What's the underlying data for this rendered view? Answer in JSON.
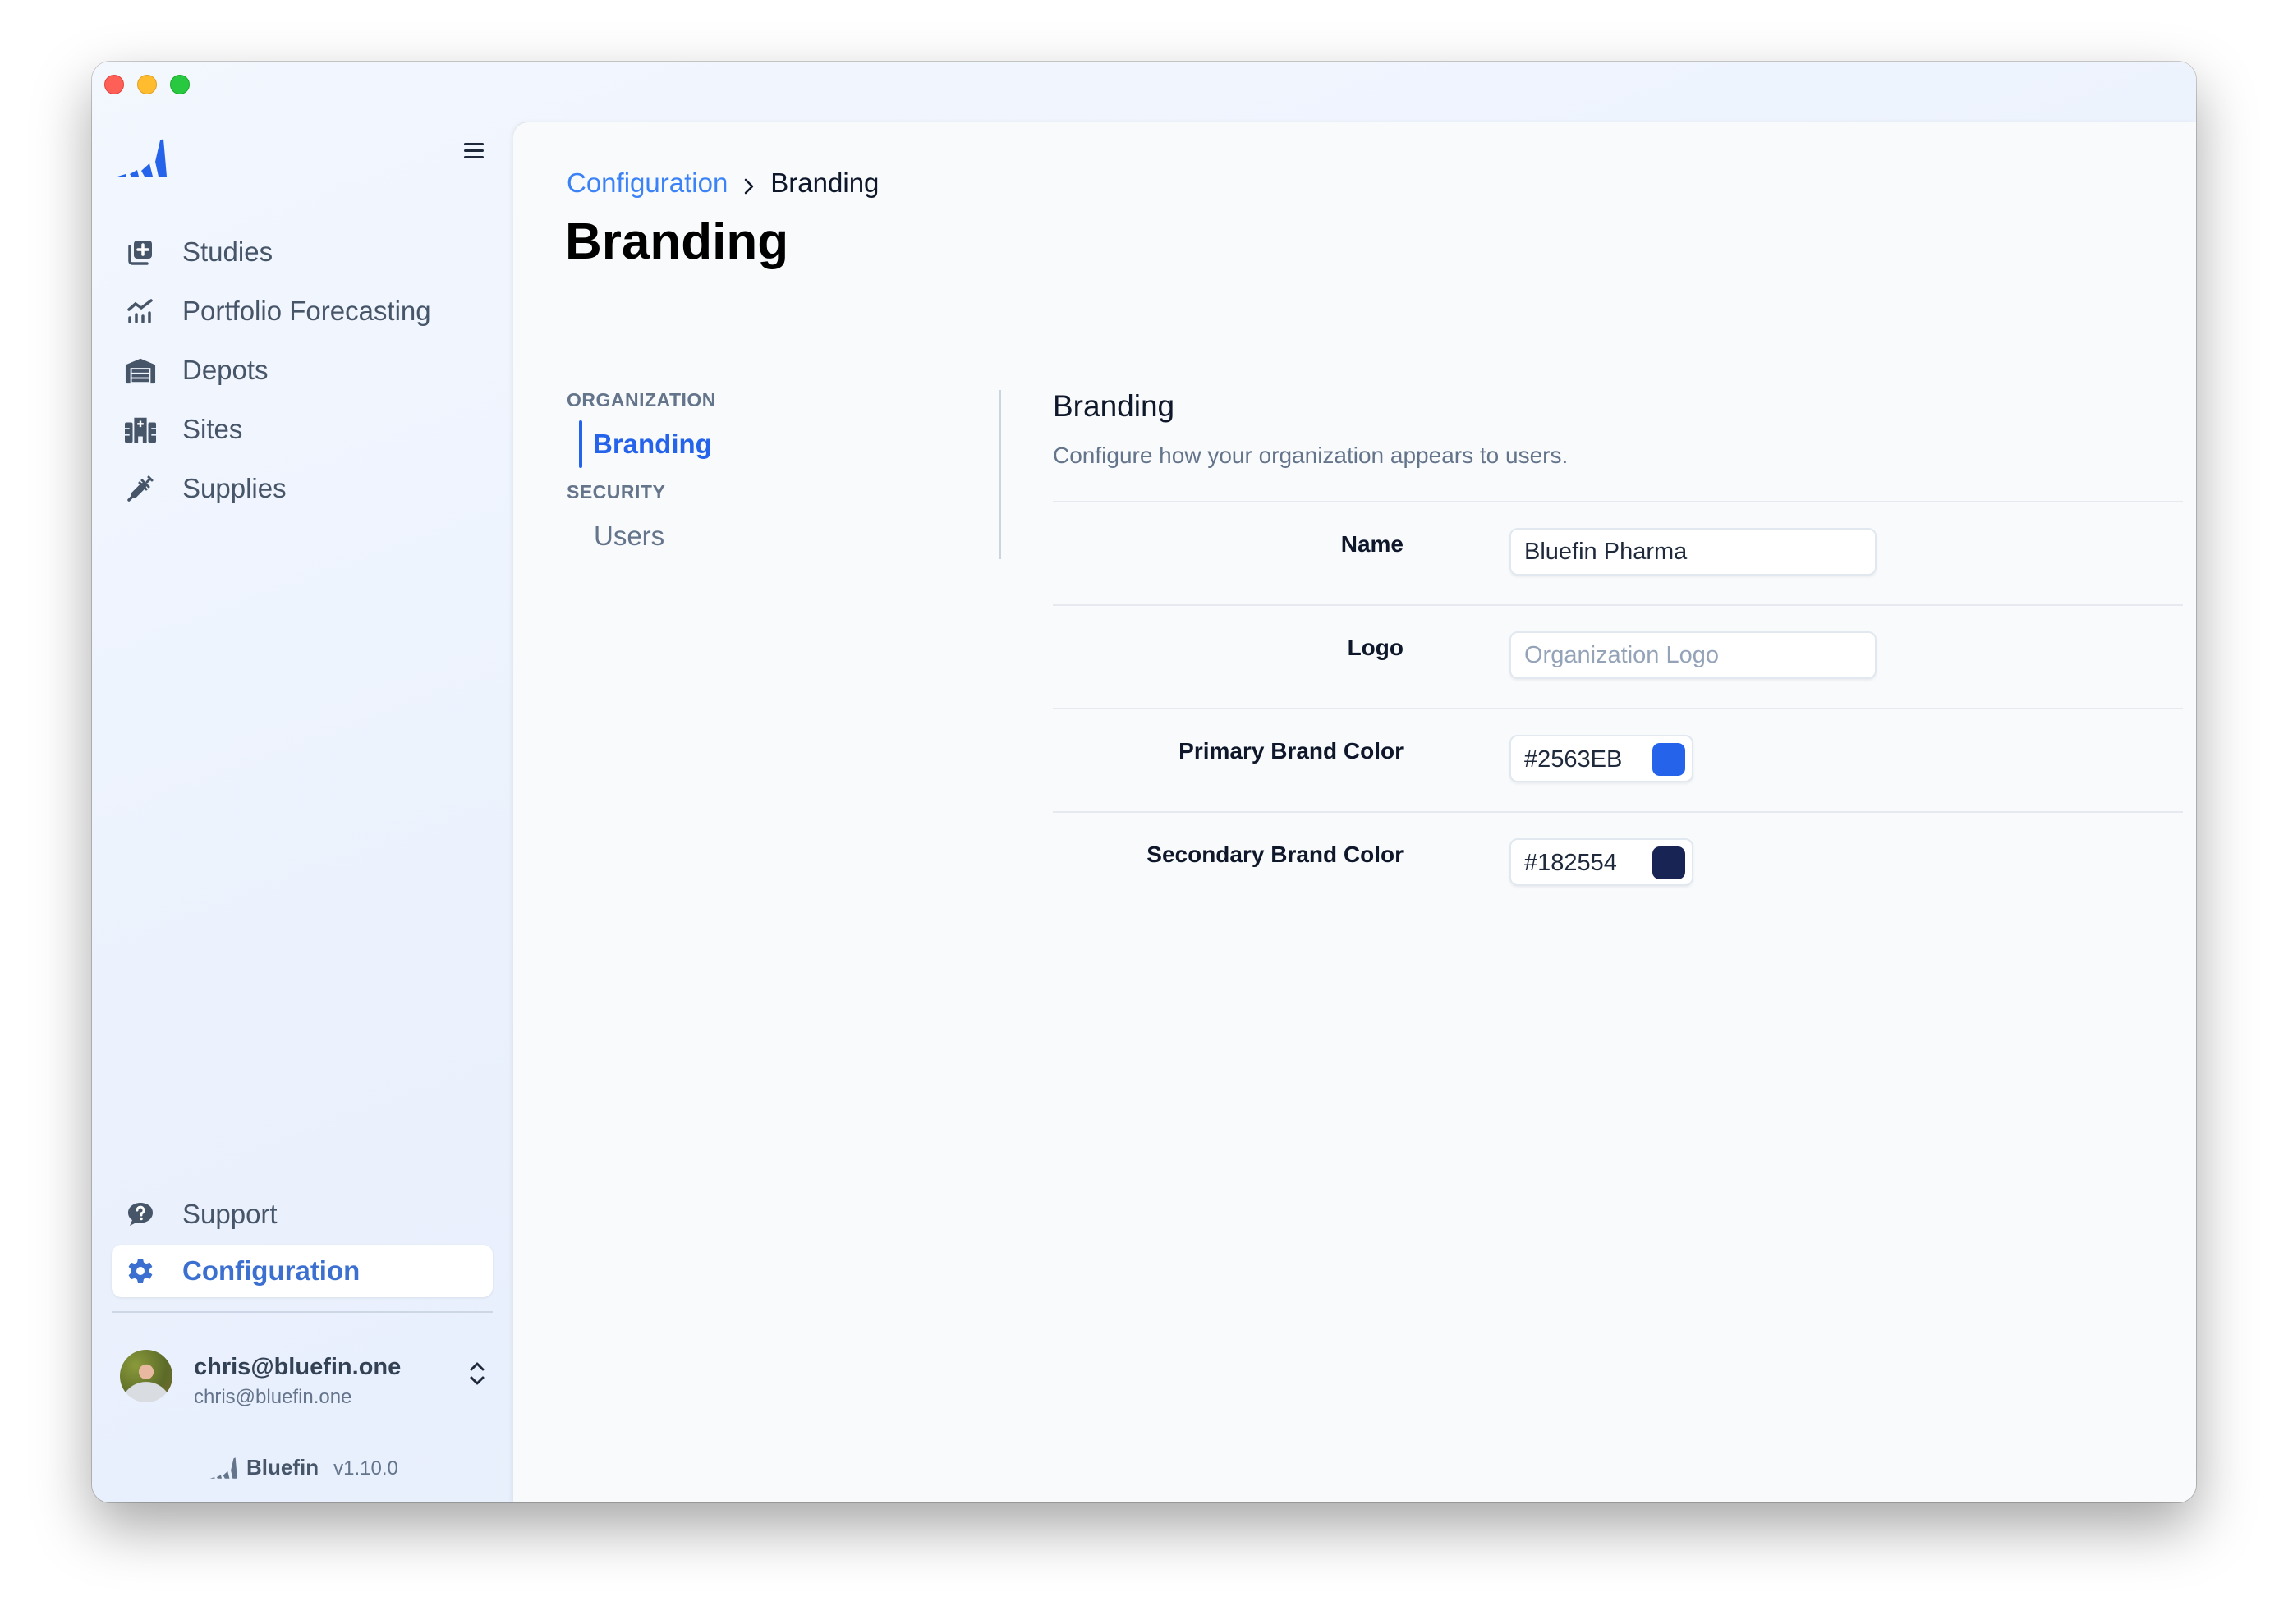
{
  "window": {
    "controls": [
      "close",
      "minimize",
      "maximize"
    ]
  },
  "sidebar": {
    "logo_icon": "bluefin-logo",
    "menu_icon": "hamburger-icon",
    "items": [
      {
        "label": "Studies",
        "icon": "studies-icon",
        "active": false
      },
      {
        "label": "Portfolio Forecasting",
        "icon": "chart-icon",
        "active": false
      },
      {
        "label": "Depots",
        "icon": "warehouse-icon",
        "active": false
      },
      {
        "label": "Sites",
        "icon": "hospital-icon",
        "active": false
      },
      {
        "label": "Supplies",
        "icon": "syringe-icon",
        "active": false
      }
    ],
    "bottom_items": [
      {
        "label": "Support",
        "icon": "help-chat-icon",
        "active": false
      },
      {
        "label": "Configuration",
        "icon": "gear-icon",
        "active": true
      }
    ],
    "user": {
      "name": "chris@bluefin.one",
      "email": "chris@bluefin.one"
    },
    "footer": {
      "brand": "Bluefin",
      "version": "v1.10.0"
    }
  },
  "main": {
    "breadcrumb": {
      "parent": "Configuration",
      "current": "Branding"
    },
    "title": "Branding",
    "subnav": {
      "groups": [
        {
          "label": "ORGANIZATION",
          "items": [
            {
              "label": "Branding",
              "active": true
            }
          ]
        },
        {
          "label": "SECURITY",
          "items": [
            {
              "label": "Users",
              "active": false
            }
          ]
        }
      ]
    },
    "section": {
      "title": "Branding",
      "description": "Configure how your organization appears to users.",
      "fields": [
        {
          "label": "Name",
          "value": "Bluefin Pharma",
          "placeholder": ""
        },
        {
          "label": "Logo",
          "value": "",
          "placeholder": "Organization Logo"
        },
        {
          "label": "Primary Brand Color",
          "value": "#2563EB",
          "swatch": "#2563EB"
        },
        {
          "label": "Secondary Brand Color",
          "value": "#182554",
          "swatch": "#182554"
        }
      ]
    }
  },
  "colors": {
    "accent": "#2563EB",
    "secondary": "#182554",
    "link": "#3B82F6",
    "sidebar_active_text": "#3B6FD0"
  }
}
